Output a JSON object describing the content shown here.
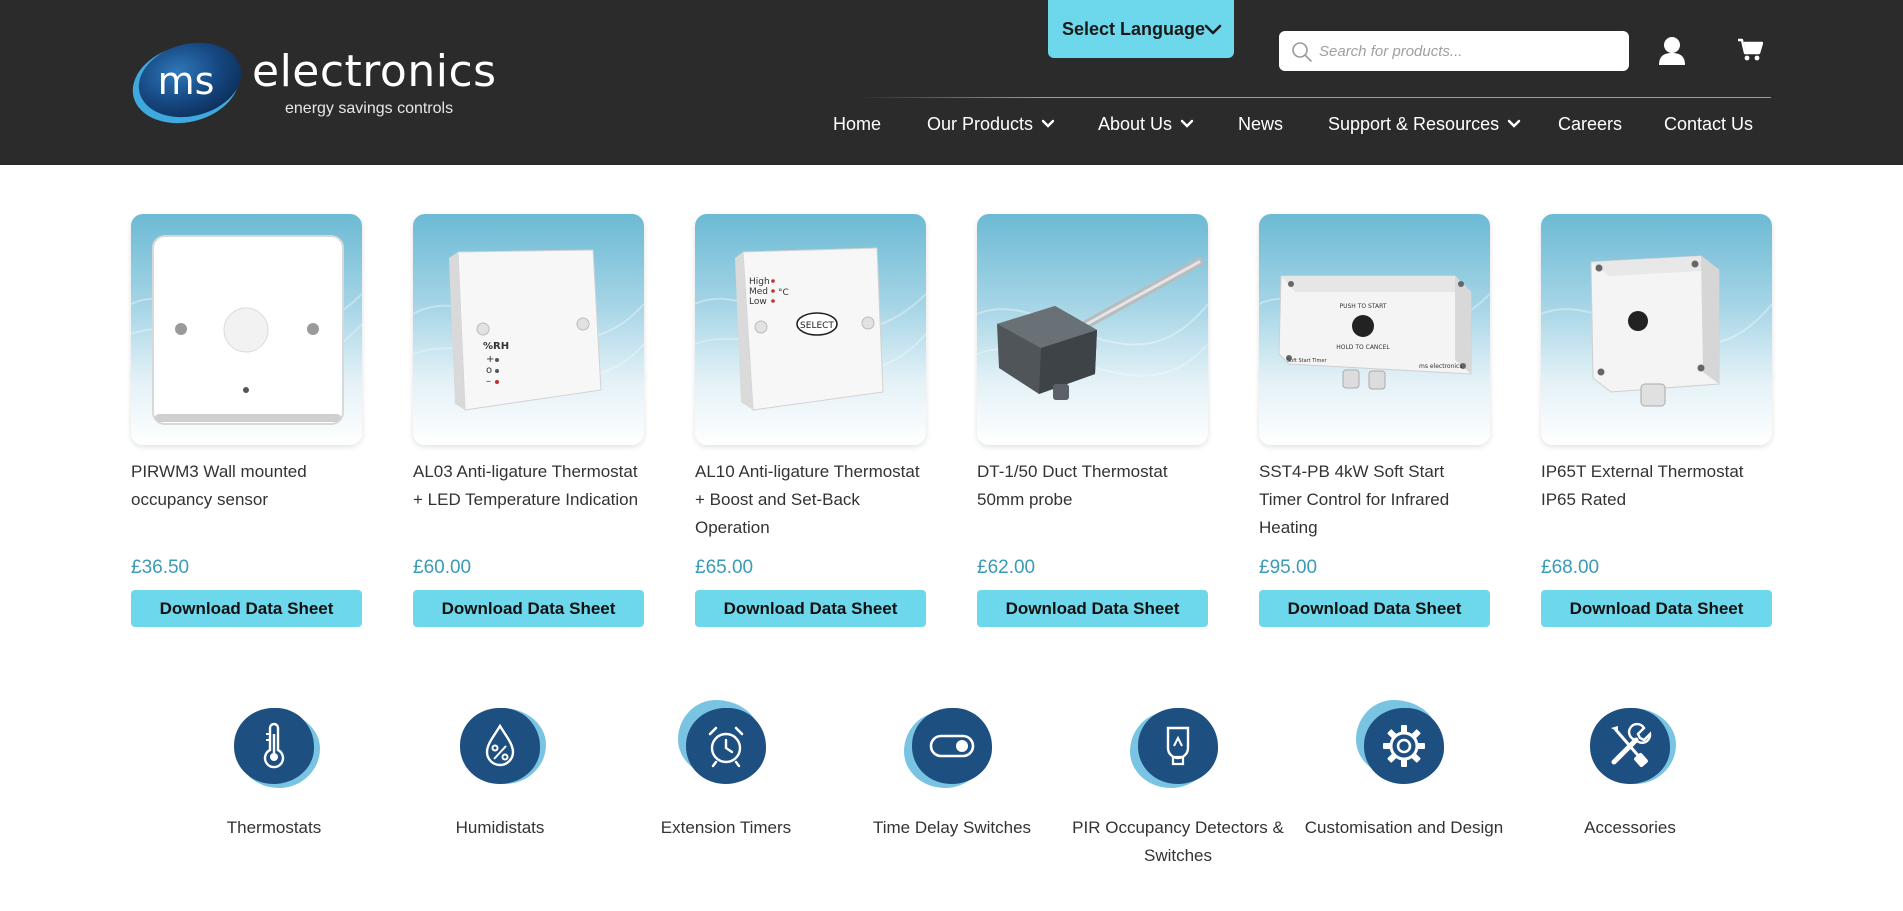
{
  "brand": {
    "name": "electronics",
    "mark": "ms",
    "tagline": "energy savings controls"
  },
  "header": {
    "language_label": "Select Language",
    "search_placeholder": "Search for products...",
    "icons": {
      "search": "search-icon",
      "account": "user-icon",
      "cart": "cart-icon",
      "chevron": "chevron-down-icon"
    }
  },
  "nav": {
    "items": [
      {
        "label": "Home",
        "dropdown": false
      },
      {
        "label": "Our Products",
        "dropdown": true
      },
      {
        "label": "About Us",
        "dropdown": true
      },
      {
        "label": "News",
        "dropdown": false
      },
      {
        "label": "Support & Resources",
        "dropdown": true
      },
      {
        "label": "Careers",
        "dropdown": false
      },
      {
        "label": "Contact Us",
        "dropdown": false
      }
    ]
  },
  "products": [
    {
      "name": "PIRWM3 Wall mounted occupancy sensor",
      "price": "£36.50",
      "button": "Download Data Sheet"
    },
    {
      "name": "AL03 Anti-ligature Thermostat + LED Temperature Indication",
      "price": "£60.00",
      "button": "Download Data Sheet",
      "image_text": [
        "%RH",
        "+",
        "o",
        "–"
      ]
    },
    {
      "name": "AL10 Anti-ligature Thermostat + Boost and Set-Back Operation",
      "price": "£65.00",
      "button": "Download Data Sheet",
      "image_text": [
        "High",
        "Med",
        "Low",
        "°C",
        "SELECT"
      ]
    },
    {
      "name": "DT-1/50 Duct Thermostat 50mm probe",
      "price": "£62.00",
      "button": "Download Data Sheet"
    },
    {
      "name": "SST4-PB 4kW Soft Start Timer Control for Infrared Heating",
      "price": "£95.00",
      "button": "Download Data Sheet",
      "image_text": [
        "PUSH TO START",
        "HOLD TO CANCEL",
        "Soft Start Timer",
        "ms electronics"
      ]
    },
    {
      "name": "IP65T External Thermostat IP65 Rated",
      "price": "£68.00",
      "button": "Download Data Sheet"
    }
  ],
  "categories": [
    {
      "label": "Thermostats",
      "icon": "thermometer-icon"
    },
    {
      "label": "Humidistats",
      "icon": "humidity-drop-icon"
    },
    {
      "label": "Extension Timers",
      "icon": "alarm-clock-icon"
    },
    {
      "label": "Time Delay Switches",
      "icon": "toggle-switch-icon"
    },
    {
      "label": "PIR Occupancy Detectors & Switches",
      "icon": "light-bulb-icon"
    },
    {
      "label": "Customisation and Design",
      "icon": "gear-icon"
    },
    {
      "label": "Accessories",
      "icon": "wrench-screwdriver-icon"
    }
  ],
  "colors": {
    "header_bg": "#2b2b2b",
    "accent": "#6dd8ec",
    "price": "#3a9bb5",
    "category_dark": "#1d4f81",
    "category_light": "#78c4e2"
  }
}
